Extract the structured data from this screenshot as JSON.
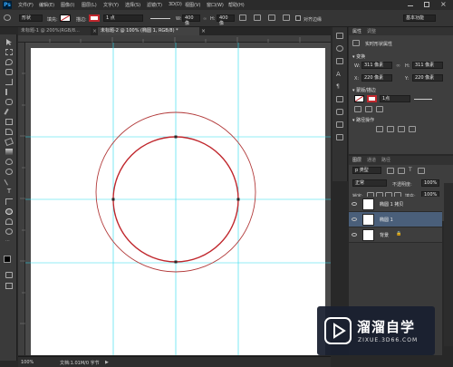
{
  "app": {
    "logo": "Ps"
  },
  "menu": [
    "文件(F)",
    "编辑(E)",
    "图像(I)",
    "图层(L)",
    "文字(Y)",
    "选择(S)",
    "滤镜(T)",
    "3D(D)",
    "视图(V)",
    "窗口(W)",
    "帮助(H)"
  ],
  "options": {
    "mode": "形状",
    "fill_label": "填充:",
    "stroke_label": "描边:",
    "stroke_width": "1 点",
    "w_label": "W:",
    "w_value": "400 像",
    "h_label": "H:",
    "h_value": "400 像",
    "align_edges": "对齐边缘",
    "workspace": "基本功能"
  },
  "tabs": [
    {
      "label": "未标题-1 @ 200%(RGB/8...",
      "close": "×"
    },
    {
      "label": "未标题-2 @ 100% (椭圆 1, RGB/8) *",
      "close": "×"
    }
  ],
  "status": {
    "zoom": "100%",
    "doc": "文档:1.01M/0 字节"
  },
  "properties": {
    "tabs": [
      "属性",
      "调整"
    ],
    "title": "实时形状属性",
    "section_transform": "变换",
    "w_label": "W:",
    "w_value": "311 像素",
    "h_label": "H:",
    "h_value": "311 像素",
    "x_label": "X:",
    "x_value": "220 像素",
    "y_label": "Y:",
    "y_value": "220 像素",
    "section_mask": "蒙版/描边",
    "stroke_width": "1点",
    "section_path": "路径操作"
  },
  "layers_panel": {
    "tabs": [
      "图层",
      "通道",
      "路径"
    ],
    "filter": "p 类型",
    "blend": "正常",
    "opacity_label": "不透明度:",
    "opacity": "100%",
    "lock_label": "锁定:",
    "fill_label": "填充:",
    "fill": "100%",
    "layers": [
      {
        "name": "椭圆 1 拷贝",
        "selected": false
      },
      {
        "name": "椭圆 1",
        "selected": true
      },
      {
        "name": "背景",
        "selected": false
      }
    ]
  },
  "watermark": {
    "title": "溜溜自学",
    "subtitle": "ZIXUE.3D66.COM"
  },
  "colors": {
    "accent": "#4a5f7a",
    "stroke": "#c0272d",
    "guide": "#28d9ec",
    "canvas": "#ffffff"
  }
}
